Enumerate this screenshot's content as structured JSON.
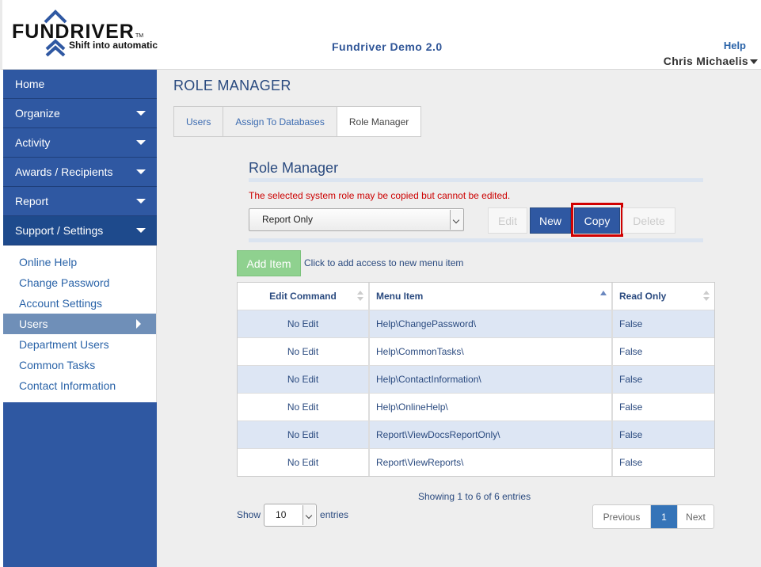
{
  "header": {
    "logo_word": "FUNDRIVER",
    "logo_tm": "TM",
    "logo_tagline": "Shift into automatic",
    "app_title": "Fundriver Demo 2.0",
    "help": "Help",
    "user": "Chris Michaelis"
  },
  "sidebar": {
    "items": [
      {
        "label": "Home",
        "has_dropdown": false
      },
      {
        "label": "Organize",
        "has_dropdown": true
      },
      {
        "label": "Activity",
        "has_dropdown": true
      },
      {
        "label": "Awards / Recipients",
        "has_dropdown": true
      },
      {
        "label": "Report",
        "has_dropdown": true
      },
      {
        "label": "Support / Settings",
        "has_dropdown": true
      }
    ],
    "submenu": [
      "Online Help",
      "Change Password",
      "Account Settings",
      "Users",
      "Department Users",
      "Common Tasks",
      "Contact Information"
    ]
  },
  "main": {
    "page_title": "ROLE MANAGER",
    "tabs": [
      "Users",
      "Assign To Databases",
      "Role Manager"
    ],
    "section_title": "Role Manager",
    "warning": "The selected system role may be copied but cannot be edited.",
    "role_select": "Report Only",
    "buttons": {
      "edit": "Edit",
      "new": "New",
      "copy": "Copy",
      "delete": "Delete"
    },
    "add_item": "Add Item",
    "add_hint": "Click to add access to new menu item",
    "table": {
      "columns": [
        "Edit Command",
        "Menu Item",
        "Read Only"
      ],
      "rows": [
        [
          "No Edit",
          "Help\\ChangePassword\\",
          "False"
        ],
        [
          "No Edit",
          "Help\\CommonTasks\\",
          "False"
        ],
        [
          "No Edit",
          "Help\\ContactInformation\\",
          "False"
        ],
        [
          "No Edit",
          "Help\\OnlineHelp\\",
          "False"
        ],
        [
          "No Edit",
          "Report\\ViewDocsReportOnly\\",
          "False"
        ],
        [
          "No Edit",
          "Report\\ViewReports\\",
          "False"
        ]
      ]
    },
    "showing": "Showing 1 to 6 of 6 entries",
    "show_label": "Show",
    "page_size": "10",
    "entries_label": "entries",
    "pager": {
      "previous": "Previous",
      "current": "1",
      "next": "Next"
    }
  },
  "colors": {
    "sidebar_bg": "#2f58a2",
    "primary_button": "#2f58a2",
    "highlight_outline": "#d10000",
    "add_item_button": "#8fd18f",
    "warning_text": "#cc0000"
  }
}
